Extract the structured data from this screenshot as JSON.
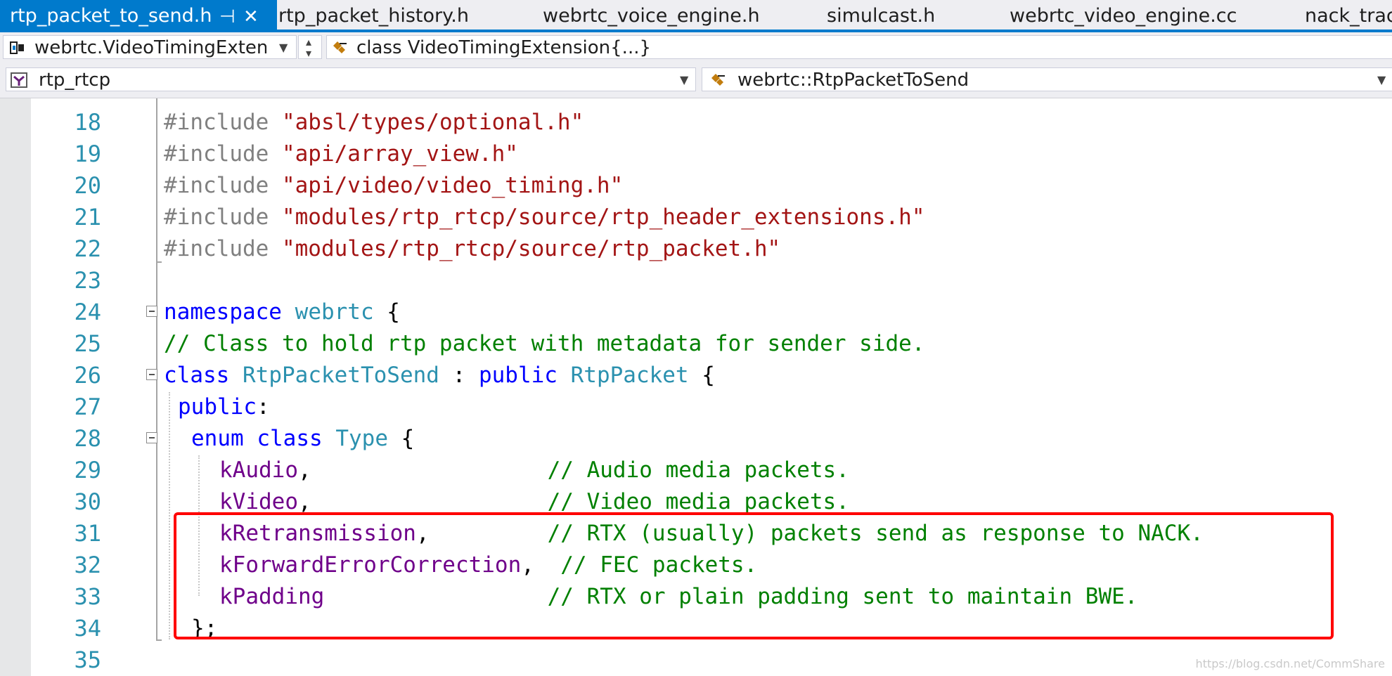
{
  "tabs": [
    {
      "label": "rtp_packet_to_send.h",
      "active": true,
      "pinned": true
    },
    {
      "label": "rtp_packet_history.h"
    },
    {
      "label": "webrtc_voice_engine.h"
    },
    {
      "label": "simulcast.h"
    },
    {
      "label": "webrtc_video_engine.cc"
    },
    {
      "label": "nack_trac"
    }
  ],
  "tab_icons": {
    "pin": "pin-icon",
    "close": "close-icon"
  },
  "nav1": {
    "scope_combo": "webrtc.VideoTimingExtens",
    "member_combo": "class VideoTimingExtension{...}"
  },
  "nav2": {
    "project_combo": "rtp_rtcp",
    "scope_combo": "webrtc::RtpPacketToSend"
  },
  "editor": {
    "line_numbers": [
      "18",
      "19",
      "20",
      "21",
      "22",
      "23",
      "24",
      "25",
      "26",
      "27",
      "28",
      "29",
      "30",
      "31",
      "32",
      "33",
      "34",
      "35"
    ],
    "lines": {
      "l18": {
        "a": "#include ",
        "b": "\"absl/types/optional.h\""
      },
      "l19": {
        "a": "#include ",
        "b": "\"api/array_view.h\""
      },
      "l20": {
        "a": "#include ",
        "b": "\"api/video/video_timing.h\""
      },
      "l21": {
        "a": "#include ",
        "b": "\"modules/rtp_rtcp/source/rtp_header_extensions.h\""
      },
      "l22": {
        "a": "#include ",
        "b": "\"modules/rtp_rtcp/source/rtp_packet.h\""
      },
      "l24": {
        "a": "namespace",
        "b": " ",
        "c": "webrtc",
        "d": " {"
      },
      "l25": {
        "a": "// Class to hold rtp packet with metadata for sender side."
      },
      "l26": {
        "a": "class",
        "b": " ",
        "c": "RtpPacketToSend",
        "d": " : ",
        "e": "public",
        "f": " ",
        "g": "RtpPacket",
        "h": " {"
      },
      "l27": {
        "a": "public",
        "b": ":"
      },
      "l28": {
        "a": "enum",
        "b": " ",
        "c": "class",
        "d": " ",
        "e": "Type",
        "f": " {"
      },
      "l29": {
        "a": "kAudio",
        "b": ",                  ",
        "c": "// Audio media packets."
      },
      "l30": {
        "a": "kVideo",
        "b": ",                  ",
        "c": "// Video media packets."
      },
      "l31": {
        "a": "kRetransmission",
        "b": ",         ",
        "c": "// RTX (usually) packets send as response to NACK."
      },
      "l32": {
        "a": "kForwardErrorCorrection",
        "b": ",  ",
        "c": "// FEC packets."
      },
      "l33": {
        "a": "kPadding",
        "b": "                 ",
        "c": "// RTX or plain padding sent to maintain BWE."
      },
      "l34": {
        "a": "};"
      }
    }
  },
  "colors": {
    "accent": "#007acc",
    "highlight": "#ff0000",
    "keyword": "#0000ff",
    "type": "#2b91af",
    "string": "#a31515",
    "comment": "#008000",
    "enum_member": "#6f008a",
    "line_number": "#2b91af"
  },
  "watermark": "https://blog.csdn.net/CommShare"
}
